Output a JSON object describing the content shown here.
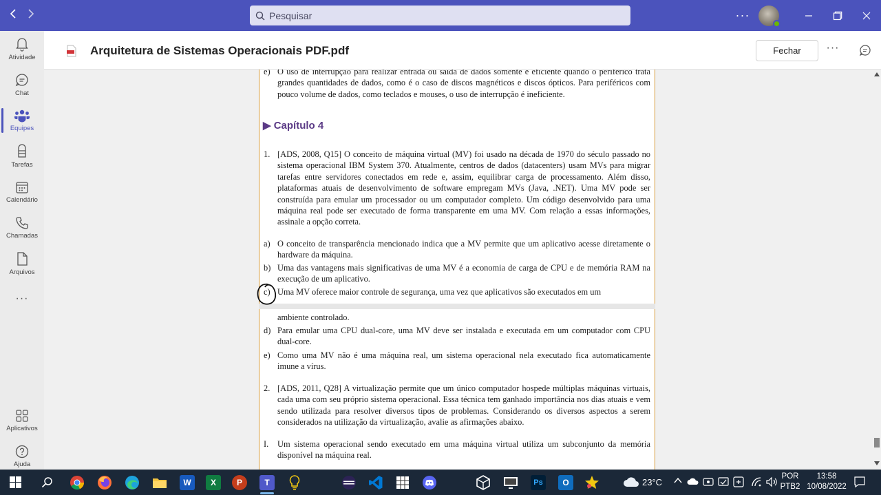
{
  "titlebar": {
    "search_placeholder": "Pesquisar",
    "more": "···"
  },
  "rail": {
    "items": [
      {
        "label": "Atividade",
        "icon": "bell-icon"
      },
      {
        "label": "Chat",
        "icon": "chat-icon"
      },
      {
        "label": "Equipes",
        "icon": "teams-icon",
        "active": true
      },
      {
        "label": "Tarefas",
        "icon": "tasks-icon"
      },
      {
        "label": "Calendário",
        "icon": "calendar-icon"
      },
      {
        "label": "Chamadas",
        "icon": "phone-icon"
      },
      {
        "label": "Arquivos",
        "icon": "file-icon"
      }
    ],
    "more": "···",
    "bottom_items": [
      {
        "label": "Aplicativos",
        "icon": "apps-icon"
      },
      {
        "label": "Ajuda",
        "icon": "help-icon"
      }
    ]
  },
  "document": {
    "title": "Arquitetura de Sistemas Operacionais PDF.pdf",
    "close_label": "Fechar",
    "more": "···"
  },
  "pdf": {
    "prev_item": {
      "marker": "e)",
      "text": "O uso de interrupção para realizar entrada ou saída de dados somente é eficiente quando o periférico trata grandes quantidades de dados, como é o caso de discos magnéticos e discos ópticos. Para periféricos com pouco volume de dados, como teclados e mouses, o uso de interrupção é ineficiente."
    },
    "chapter": "▶ Capítulo 4",
    "q1": {
      "marker": "1.",
      "text": "[ADS, 2008, Q15] O conceito de máquina virtual (MV) foi usado na década de 1970 do século passado no sistema operacional IBM System 370. Atualmente, centros de dados (datacenters) usam MVs para migrar tarefas entre servidores conectados em rede e, assim, equilibrar carga de processamento. Além disso, plataformas atuais de desenvolvimento de software empregam MVs (Java, .NET). Uma MV pode ser construída para emular um processador ou um computador completo. Um código desenvolvido para uma máquina real pode ser executado de forma transparente em uma MV. Com relação a essas informações, assinale a opção correta."
    },
    "q1_options": [
      {
        "marker": "a)",
        "text": "O conceito de transparência mencionado indica que a MV permite que um aplicativo acesse diretamente o hardware da máquina."
      },
      {
        "marker": "b)",
        "text": "Uma das vantagens mais significativas de uma MV é a economia de carga de CPU e de memória RAM na execução de um aplicativo."
      },
      {
        "marker": "c)",
        "text": "Uma MV oferece maior controle de segurança, uma vez que aplicativos são executados em um"
      }
    ],
    "page2_continuation": "ambiente controlado.",
    "q1_options_2": [
      {
        "marker": "d)",
        "text": "Para emular uma CPU dual-core, uma MV deve ser instalada e executada em um computador com CPU dual-core."
      },
      {
        "marker": "e)",
        "text": "Como uma MV não é uma máquina real, um sistema operacional nela executado fica automaticamente imune a vírus."
      }
    ],
    "q2": {
      "marker": "2.",
      "text": "[ADS, 2011, Q28] A virtualização permite que um único computador hospede múltiplas máquinas virtuais, cada uma com seu próprio sistema operacional. Essa técnica tem ganhado importância nos dias atuais e vem sendo utilizada para resolver diversos tipos de problemas. Considerando os diversos aspectos a serem considerados na utilização da virtualização, avalie as afirmações abaixo."
    },
    "q2_items": [
      {
        "marker": "I.",
        "text": "Um sistema operacional sendo executado em uma máquina virtual utiliza um subconjunto da memória disponível na máquina real."
      }
    ]
  },
  "taskbar": {
    "apps": [
      "windows-start",
      "search",
      "chrome",
      "firefox",
      "edge",
      "file-explorer",
      "word",
      "excel",
      "powerpoint",
      "teams",
      "lightbulb",
      "eclipse",
      "vscode",
      "app-grid",
      "discord",
      "virtualbox",
      "display",
      "photoshop",
      "outlook",
      "starred-app"
    ],
    "app_letters": {
      "word": "W",
      "excel": "X",
      "powerpoint": "P",
      "photoshop": "Ps",
      "teams": "T",
      "outlook": "O"
    },
    "weather": "23°C",
    "lang_top": "POR",
    "lang_bottom": "PTB2",
    "time": "13:58",
    "date": "10/08/2022"
  },
  "colors": {
    "teams_purple": "#4b53bc",
    "chapter_purple": "#5b3a86",
    "page_border": "#d69a3a",
    "taskbar": "#1b2838"
  }
}
